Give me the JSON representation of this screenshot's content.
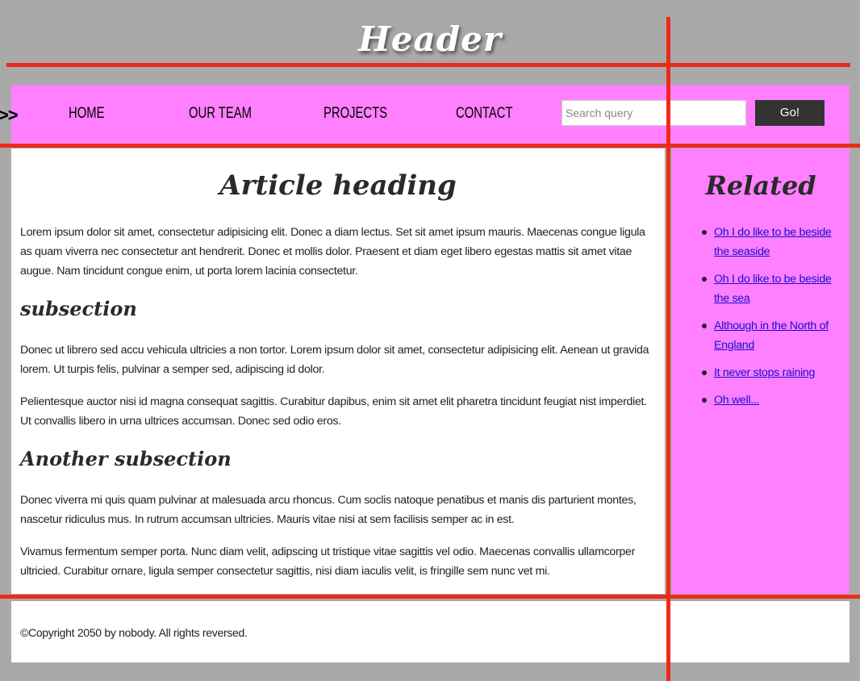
{
  "header": {
    "title": "Header"
  },
  "nav": {
    "arrows": ">>>",
    "items": [
      {
        "label": "HOME"
      },
      {
        "label": "OUR TEAM"
      },
      {
        "label": "PROJECTS"
      },
      {
        "label": "CONTACT"
      }
    ],
    "search": {
      "placeholder": "Search query",
      "value": ""
    },
    "go_label": "Go!"
  },
  "article": {
    "heading": "Article heading",
    "intro": "Lorem ipsum dolor sit amet, consectetur adipisicing elit. Donec a diam lectus. Set sit amet ipsum mauris. Maecenas congue ligula as quam viverra nec consectetur ant hendrerit. Donec et mollis dolor. Praesent et diam eget libero egestas mattis sit amet vitae augue. Nam tincidunt congue enim, ut porta lorem lacinia consectetur.",
    "sections": [
      {
        "heading": "subsection",
        "paragraphs": [
          "Donec ut librero sed accu vehicula ultricies a non tortor. Lorem ipsum dolor sit amet, consectetur adipisicing elit. Aenean ut gravida lorem. Ut turpis felis, pulvinar a semper sed, adipiscing id dolor.",
          "Pelientesque auctor nisi id magna consequat sagittis. Curabitur dapibus, enim sit amet elit pharetra tincidunt feugiat nist imperdiet. Ut convallis libero in urna ultrices accumsan. Donec sed odio eros."
        ]
      },
      {
        "heading": "Another subsection",
        "paragraphs": [
          "Donec viverra mi quis quam pulvinar at malesuada arcu rhoncus. Cum soclis natoque penatibus et manis dis parturient montes, nascetur ridiculus mus. In rutrum accumsan ultricies. Mauris vitae nisi at sem facilisis semper ac in est.",
          "Vivamus fermentum semper porta. Nunc diam velit, adipscing ut tristique vitae sagittis vel odio. Maecenas convallis ullamcorper ultricied. Curabitur ornare, ligula semper consectetur sagittis, nisi diam iaculis velit, is fringille sem nunc vet mi."
        ]
      }
    ]
  },
  "sidebar": {
    "heading": "Related",
    "links": [
      {
        "label": "Oh I do like to be beside the seaside"
      },
      {
        "label": "Oh I do like to be beside the sea"
      },
      {
        "label": "Although in the North of England"
      },
      {
        "label": "It never stops raining"
      },
      {
        "label": "Oh well..."
      }
    ]
  },
  "footer": {
    "text": "©Copyright 2050 by nobody. All rights reversed."
  },
  "colors": {
    "page_background": "#a9a9a9",
    "nav_background": "#ff80ff",
    "guide_lines": "#ee2a1d",
    "button_background": "#333333",
    "link": "#1a0dcc"
  }
}
